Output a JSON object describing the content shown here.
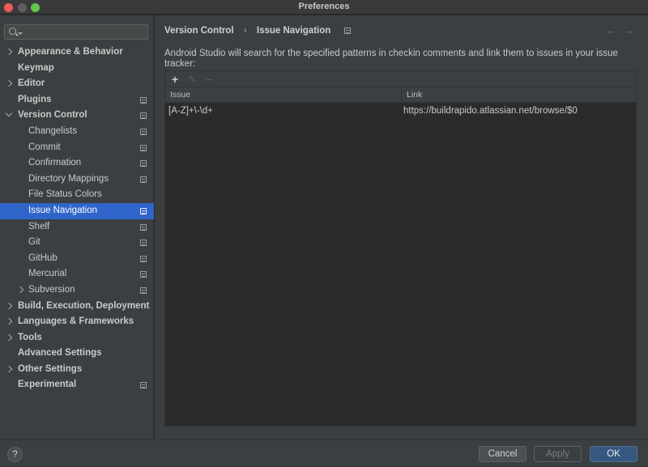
{
  "window": {
    "title": "Preferences"
  },
  "search": {
    "placeholder": ""
  },
  "sidebar": {
    "items": [
      {
        "label": "Appearance & Behavior",
        "level": 0,
        "bold": true,
        "arrow": "right",
        "project": false,
        "selected": false
      },
      {
        "label": "Keymap",
        "level": 0,
        "bold": true,
        "arrow": "",
        "project": false,
        "selected": false
      },
      {
        "label": "Editor",
        "level": 0,
        "bold": true,
        "arrow": "right",
        "project": false,
        "selected": false
      },
      {
        "label": "Plugins",
        "level": 0,
        "bold": true,
        "arrow": "",
        "project": true,
        "selected": false
      },
      {
        "label": "Version Control",
        "level": 0,
        "bold": true,
        "arrow": "down",
        "project": true,
        "selected": false
      },
      {
        "label": "Changelists",
        "level": 1,
        "bold": false,
        "arrow": "",
        "project": true,
        "selected": false
      },
      {
        "label": "Commit",
        "level": 1,
        "bold": false,
        "arrow": "",
        "project": true,
        "selected": false
      },
      {
        "label": "Confirmation",
        "level": 1,
        "bold": false,
        "arrow": "",
        "project": true,
        "selected": false
      },
      {
        "label": "Directory Mappings",
        "level": 1,
        "bold": false,
        "arrow": "",
        "project": true,
        "selected": false
      },
      {
        "label": "File Status Colors",
        "level": 1,
        "bold": false,
        "arrow": "",
        "project": false,
        "selected": false
      },
      {
        "label": "Issue Navigation",
        "level": 1,
        "bold": false,
        "arrow": "",
        "project": true,
        "selected": true
      },
      {
        "label": "Shelf",
        "level": 1,
        "bold": false,
        "arrow": "",
        "project": true,
        "selected": false
      },
      {
        "label": "Git",
        "level": 1,
        "bold": false,
        "arrow": "",
        "project": true,
        "selected": false
      },
      {
        "label": "GitHub",
        "level": 1,
        "bold": false,
        "arrow": "",
        "project": true,
        "selected": false
      },
      {
        "label": "Mercurial",
        "level": 1,
        "bold": false,
        "arrow": "",
        "project": true,
        "selected": false
      },
      {
        "label": "Subversion",
        "level": 1,
        "bold": false,
        "arrow": "right",
        "project": true,
        "selected": false
      },
      {
        "label": "Build, Execution, Deployment",
        "level": 0,
        "bold": true,
        "arrow": "right",
        "project": false,
        "selected": false
      },
      {
        "label": "Languages & Frameworks",
        "level": 0,
        "bold": true,
        "arrow": "right",
        "project": false,
        "selected": false
      },
      {
        "label": "Tools",
        "level": 0,
        "bold": true,
        "arrow": "right",
        "project": false,
        "selected": false
      },
      {
        "label": "Advanced Settings",
        "level": 0,
        "bold": true,
        "arrow": "",
        "project": false,
        "selected": false
      },
      {
        "label": "Other Settings",
        "level": 0,
        "bold": true,
        "arrow": "right",
        "project": false,
        "selected": false
      },
      {
        "label": "Experimental",
        "level": 0,
        "bold": true,
        "arrow": "",
        "project": true,
        "selected": false
      }
    ]
  },
  "breadcrumb": {
    "parent": "Version Control",
    "separator": "›",
    "current": "Issue Navigation"
  },
  "nav": {
    "back": "←",
    "forward": "→"
  },
  "main": {
    "description": "Android Studio will search for the specified patterns in checkin comments and link them to issues in your issue tracker:",
    "toolbar": {
      "add": "+",
      "edit": "✎",
      "remove": "−"
    },
    "table": {
      "columns": [
        "Issue",
        "Link"
      ],
      "rows": [
        {
          "issue": "[A-Z]+\\-\\d+",
          "link": "https://buildrapido.atlassian.net/browse/$0"
        }
      ]
    }
  },
  "footer": {
    "help": "?",
    "cancel": "Cancel",
    "apply": "Apply",
    "ok": "OK"
  },
  "colors": {
    "selection": "#2f65ca",
    "ok_button": "#365880"
  }
}
